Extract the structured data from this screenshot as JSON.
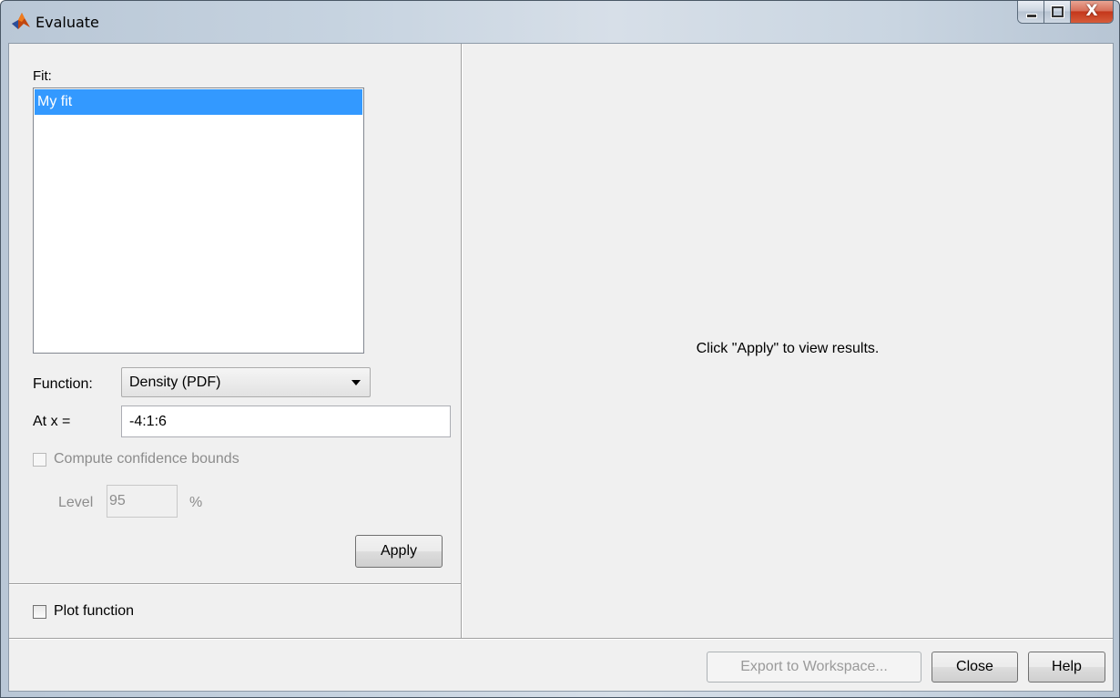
{
  "window": {
    "title": "Evaluate",
    "close_glyph": "X",
    "icon": "matlab-icon"
  },
  "left": {
    "fit_label": "Fit:",
    "fit_items": [
      "My fit"
    ],
    "function_label": "Function:",
    "function_selected": "Density (PDF)",
    "atx_label": "At x =",
    "atx_value": "-4:1:6",
    "confidence_label": "Compute confidence bounds",
    "level_label": "Level",
    "level_value": "95",
    "percent_label": "%",
    "apply_label": "Apply",
    "plot_function_label": "Plot function"
  },
  "right": {
    "message": "Click \"Apply\" to view results."
  },
  "footer": {
    "export_label": "Export to Workspace...",
    "close_label": "Close",
    "help_label": "Help"
  },
  "colors": {
    "selection": "#3399ff",
    "disabled_text": "#8c8c8c"
  }
}
